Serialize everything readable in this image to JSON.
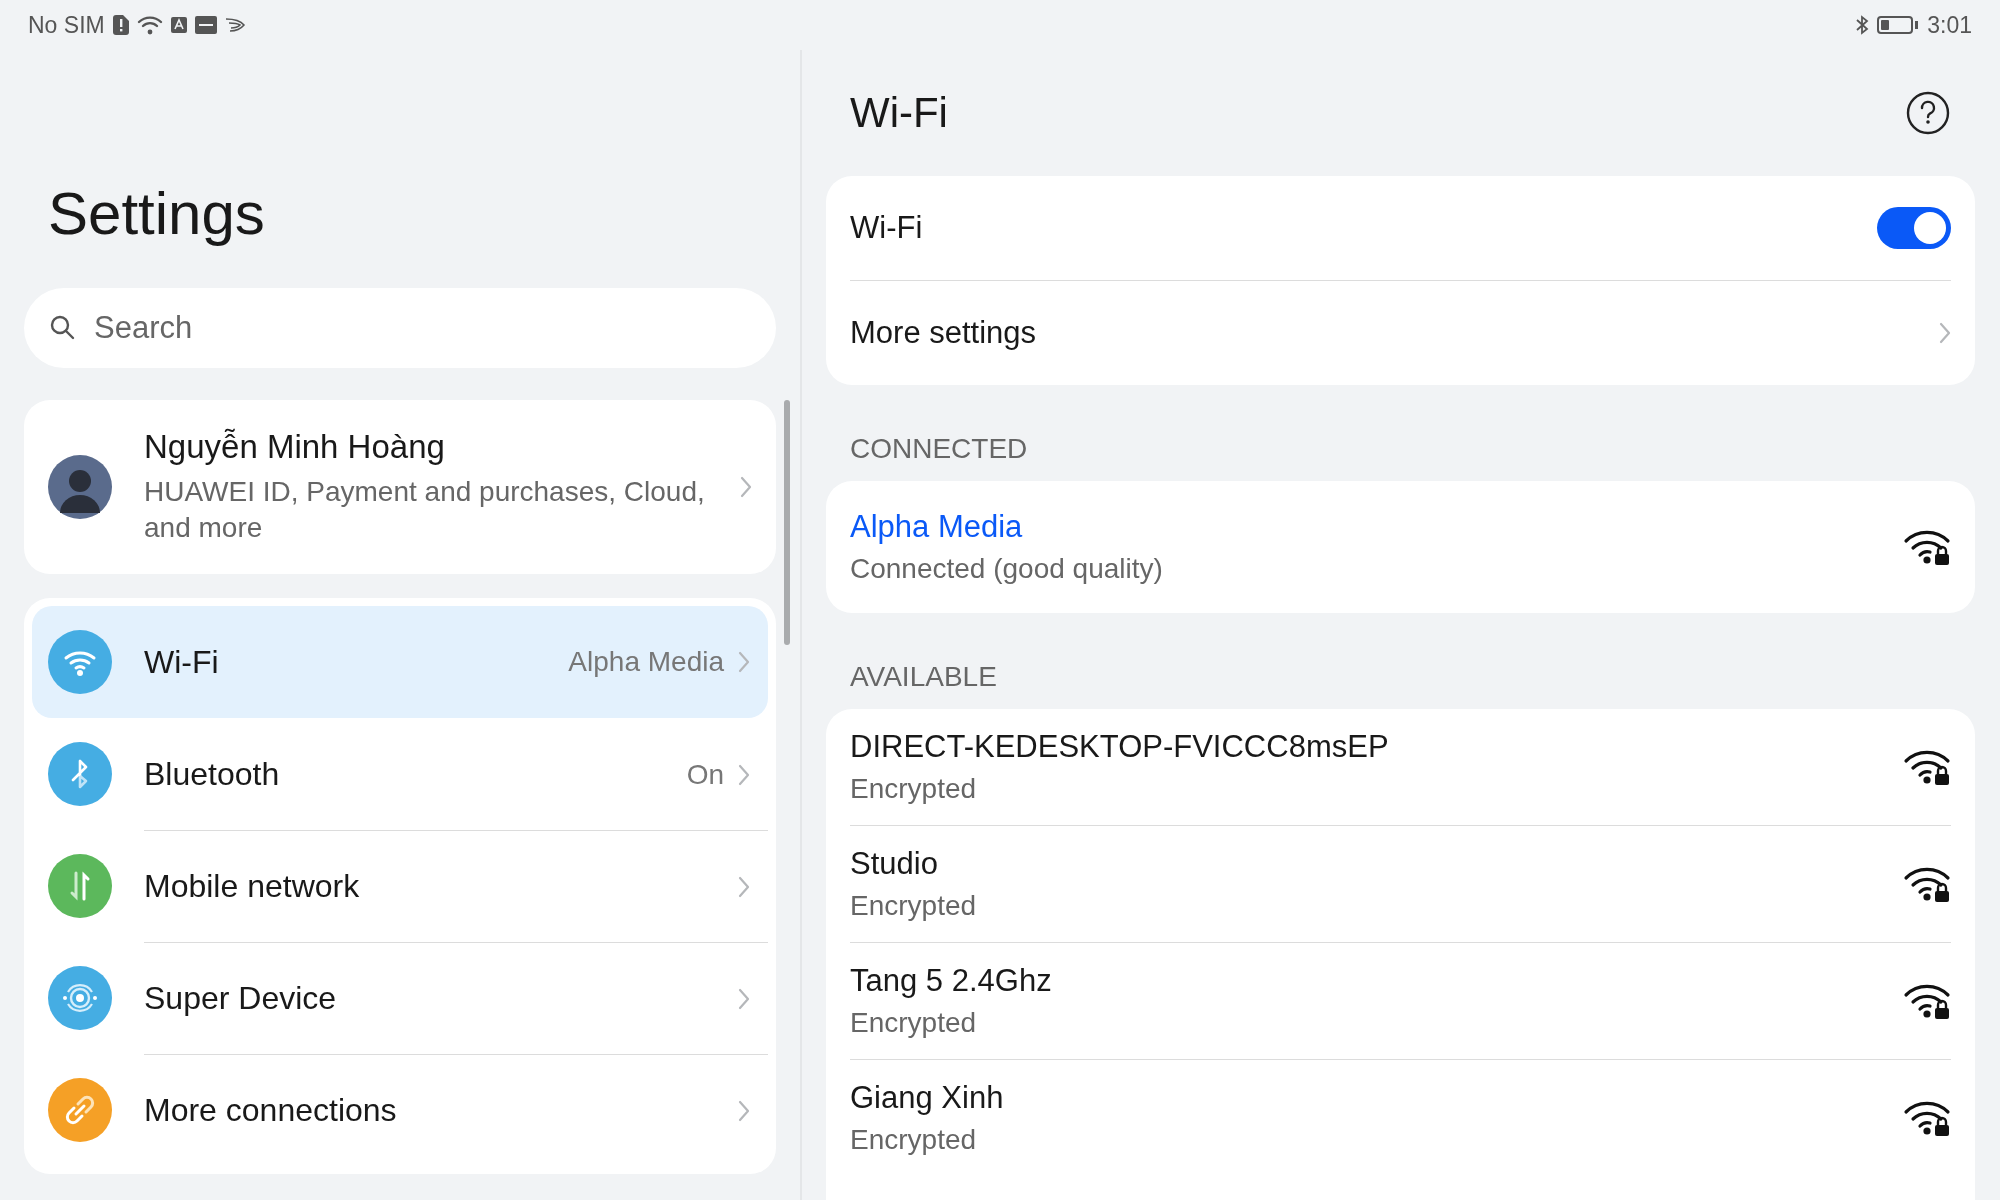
{
  "status_bar": {
    "carrier": "No SIM",
    "time": "3:01"
  },
  "settings": {
    "title": "Settings",
    "search": {
      "placeholder": "Search"
    },
    "account": {
      "name": "Nguyễn Minh Hoàng",
      "subtitle": "HUAWEI ID, Payment and purchases, Cloud, and more"
    },
    "items": [
      {
        "label": "Wi-Fi",
        "value": "Alpha Media",
        "color": "#45ade3",
        "selected": true
      },
      {
        "label": "Bluetooth",
        "value": "On",
        "color": "#45ade3",
        "selected": false
      },
      {
        "label": "Mobile network",
        "color": "#5cb85c",
        "selected": false
      },
      {
        "label": "Super Device",
        "color": "#45ade3",
        "selected": false
      },
      {
        "label": "More connections",
        "color": "#f5a026",
        "selected": false
      }
    ]
  },
  "wifi": {
    "title": "Wi-Fi",
    "toggle": {
      "label": "Wi-Fi",
      "on": true
    },
    "more_settings": "More settings",
    "connected_header": "CONNECTED",
    "connected": {
      "name": "Alpha Media",
      "status": "Connected (good quality)"
    },
    "available_header": "AVAILABLE",
    "available": [
      {
        "name": "DIRECT-KEDESKTOP-FVICCC8msEP",
        "status": "Encrypted"
      },
      {
        "name": "Studio",
        "status": "Encrypted"
      },
      {
        "name": "Tang 5 2.4Ghz",
        "status": "Encrypted"
      },
      {
        "name": "Giang Xinh",
        "status": "Encrypted"
      }
    ]
  }
}
